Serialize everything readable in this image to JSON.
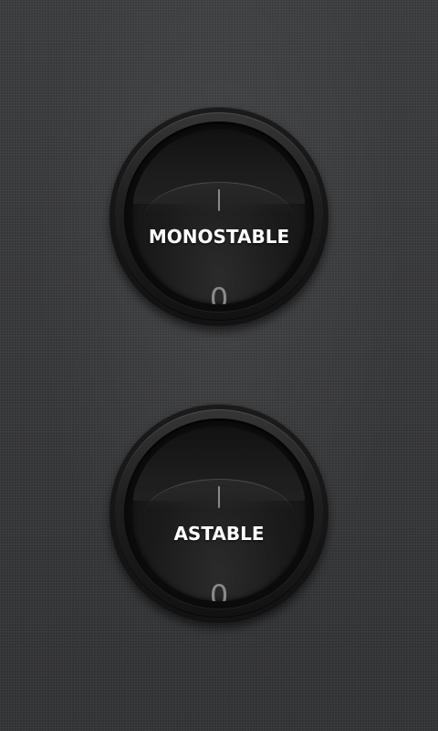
{
  "switches": [
    {
      "label": "MONOSTABLE",
      "on_mark": "I",
      "off_mark": "0",
      "state": "off"
    },
    {
      "label": "ASTABLE",
      "on_mark": "I",
      "off_mark": "0",
      "state": "off"
    }
  ],
  "colors": {
    "background": "#3a3b3d",
    "switch_body": "#141414",
    "label_text": "#ffffff",
    "mark_text": "#8a8a8c"
  }
}
